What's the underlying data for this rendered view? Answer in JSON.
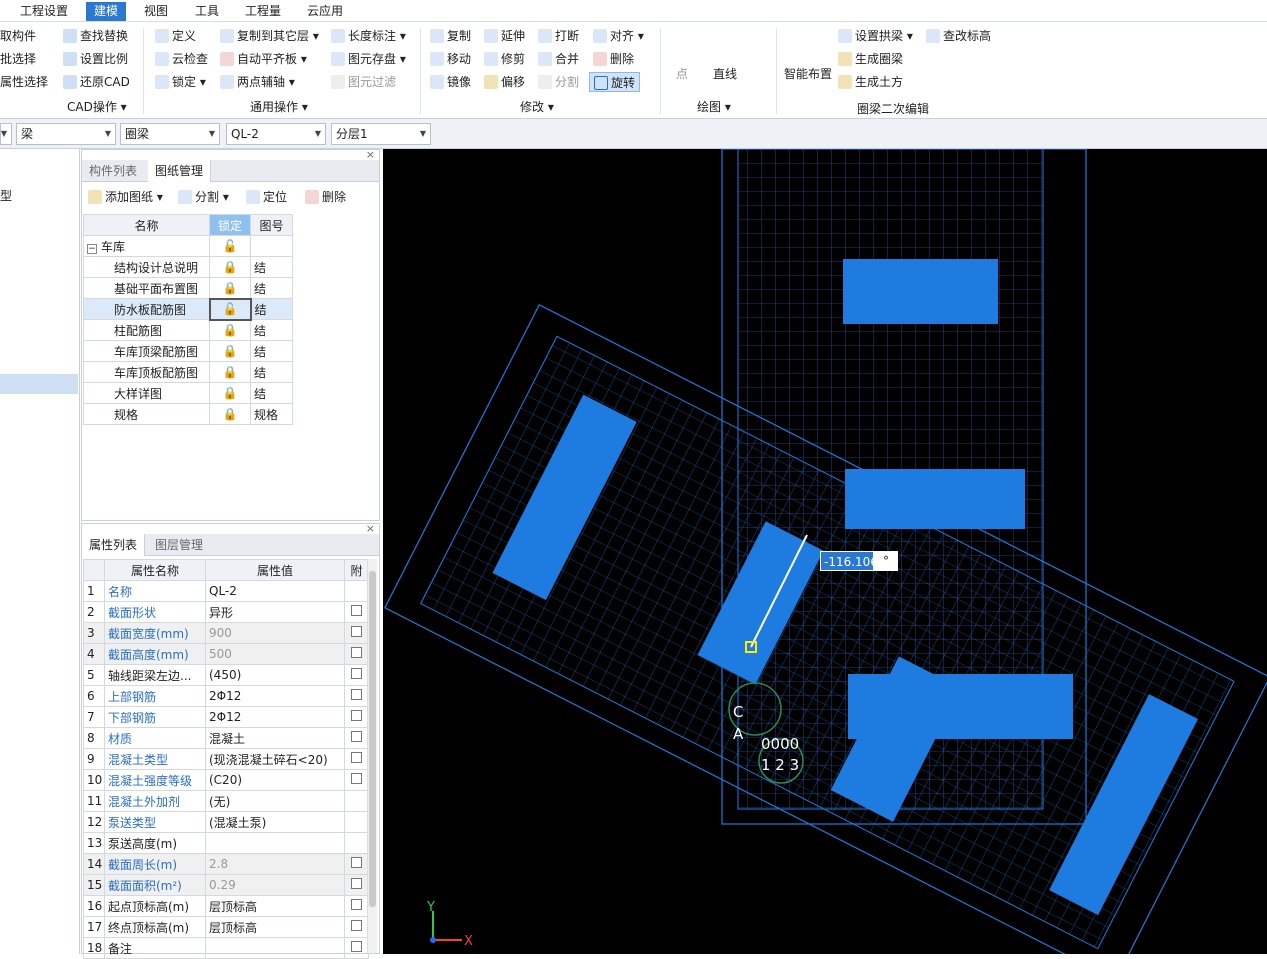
{
  "menu": {
    "tabs": [
      "工程设置",
      "建模",
      "视图",
      "工具",
      "工程量",
      "云应用"
    ]
  },
  "ribbon": {
    "col1": [
      "取构件",
      "批选择",
      "属性选择"
    ],
    "col2": [
      "查找替换",
      "设置比例",
      "还原CAD"
    ],
    "cad_group": "CAD操作",
    "col3": [
      "定义",
      "云检查",
      "锁定"
    ],
    "col4": [
      "复制到其它层",
      "自动平齐板",
      "两点辅轴"
    ],
    "col5": [
      "长度标注",
      "图元存盘",
      "图元过滤"
    ],
    "general_group": "通用操作",
    "col6": [
      "复制",
      "移动",
      "镜像"
    ],
    "col7": [
      "延伸",
      "修剪",
      "偏移"
    ],
    "col8": [
      "打断",
      "合并",
      "分割"
    ],
    "col9": [
      "对齐",
      "删除",
      "旋转"
    ],
    "modify_group": "修改",
    "draw": {
      "point": "点",
      "line": "直线",
      "group": "绘图"
    },
    "smart": "智能布置",
    "col10": [
      "设置拱梁",
      "生成圈梁",
      "生成土方"
    ],
    "change_top": "查改标高",
    "ring_group": "圈梁二次编辑"
  },
  "toolbar": {
    "c1": "",
    "c2": "梁",
    "c3": "圈梁",
    "c4": "QL-2",
    "c5": "分层1"
  },
  "nav": {
    "item": "型"
  },
  "comp": {
    "tabs": [
      "构件列表",
      "图纸管理"
    ],
    "actions": [
      "添加图纸",
      "分割",
      "定位",
      "删除"
    ],
    "headers": [
      "名称",
      "锁定",
      "图号"
    ],
    "root": "车库",
    "rows": [
      {
        "name": "结构设计总说明",
        "no": "结"
      },
      {
        "name": "基础平面布置图",
        "no": "结"
      },
      {
        "name": "防水板配筋图",
        "no": "结"
      },
      {
        "name": "柱配筋图",
        "no": "结"
      },
      {
        "name": "车库顶梁配筋图",
        "no": "结"
      },
      {
        "name": "车库顶板配筋图",
        "no": "结"
      },
      {
        "name": "大样详图",
        "no": "结"
      },
      {
        "name": "规格",
        "no": "规格"
      }
    ]
  },
  "prop": {
    "tabs": [
      "属性列表",
      "图层管理"
    ],
    "headers": [
      "属性名称",
      "属性值",
      "附"
    ],
    "rows": [
      {
        "n": "1",
        "name": "名称",
        "val": "QL-2",
        "blue": true,
        "cb": false
      },
      {
        "n": "2",
        "name": "截面形状",
        "val": "异形",
        "blue": true,
        "cb": true
      },
      {
        "n": "3",
        "name": "截面宽度(mm)",
        "val": "900",
        "blue": true,
        "cb": true,
        "gray": true
      },
      {
        "n": "4",
        "name": "截面高度(mm)",
        "val": "500",
        "blue": true,
        "cb": true,
        "gray": true
      },
      {
        "n": "5",
        "name": "轴线距梁左边...",
        "val": "(450)",
        "blue": false,
        "cb": true
      },
      {
        "n": "6",
        "name": "上部钢筋",
        "val": "2Φ12",
        "blue": true,
        "cb": true
      },
      {
        "n": "7",
        "name": "下部钢筋",
        "val": "2Φ12",
        "blue": true,
        "cb": true
      },
      {
        "n": "8",
        "name": "材质",
        "val": "混凝土",
        "blue": true,
        "cb": true
      },
      {
        "n": "9",
        "name": "混凝土类型",
        "val": "(现浇混凝土碎石<20)",
        "blue": true,
        "cb": true
      },
      {
        "n": "10",
        "name": "混凝土强度等级",
        "val": "(C20)",
        "blue": true,
        "cb": true
      },
      {
        "n": "11",
        "name": "混凝土外加剂",
        "val": "(无)",
        "blue": true,
        "cb": false
      },
      {
        "n": "12",
        "name": "泵送类型",
        "val": "(混凝土泵)",
        "blue": true,
        "cb": false
      },
      {
        "n": "13",
        "name": "泵送高度(m)",
        "val": "",
        "blue": false,
        "cb": false
      },
      {
        "n": "14",
        "name": "截面周长(m)",
        "val": "2.8",
        "blue": true,
        "cb": true,
        "gray": true
      },
      {
        "n": "15",
        "name": "截面面积(m²)",
        "val": "0.29",
        "blue": true,
        "cb": true,
        "gray": true
      },
      {
        "n": "16",
        "name": "起点顶标高(m)",
        "val": "层顶标高",
        "blue": false,
        "cb": true
      },
      {
        "n": "17",
        "name": "终点顶标高(m)",
        "val": "层顶标高",
        "blue": false,
        "cb": true
      },
      {
        "n": "18",
        "name": "备注",
        "val": "",
        "blue": false,
        "cb": true
      }
    ]
  },
  "viewport": {
    "angle": "-116.106",
    "degree": "°",
    "axis_y": "Y",
    "axis_x": "X",
    "labels": [
      "C",
      "A",
      "1 2 3",
      "0000"
    ]
  },
  "colors": {
    "accent": "#2b78d0",
    "cad": "#1e7be0",
    "canvas": "#000000"
  }
}
